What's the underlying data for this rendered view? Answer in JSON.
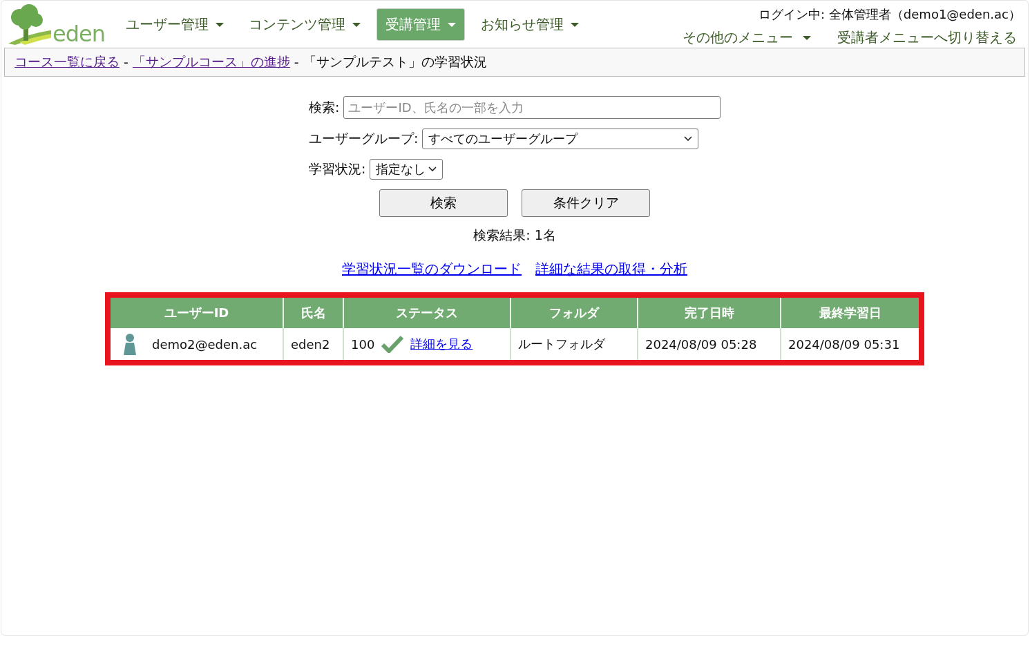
{
  "logo": {
    "text": "eden"
  },
  "nav": [
    {
      "label": "ユーザー管理",
      "selected": false,
      "dropdown": true
    },
    {
      "label": "コンテンツ管理",
      "selected": false,
      "dropdown": true
    },
    {
      "label": "受講管理",
      "selected": true,
      "dropdown": true
    },
    {
      "label": "お知らせ管理",
      "selected": false,
      "dropdown": true
    }
  ],
  "login_info": "ログイン中: 全体管理者（demo1@eden.ac）",
  "secondary_nav": [
    {
      "label": "その他のメニュー",
      "dropdown": true
    },
    {
      "label": "受講者メニューへ切り替える",
      "dropdown": false
    }
  ],
  "breadcrumb": {
    "links": [
      "コース一覧に戻る",
      "「サンプルコース」の進捗"
    ],
    "separator": "-",
    "current": "「サンプルテスト」の学習状況"
  },
  "search": {
    "label": "検索:",
    "placeholder": "ユーザーID、氏名の一部を入力"
  },
  "user_group": {
    "label": "ユーザーグループ:",
    "value": "すべてのユーザーグループ"
  },
  "study_status": {
    "label": "学習状況:",
    "value": "指定なし"
  },
  "buttons": [
    "検索",
    "条件クリア"
  ],
  "result_count": "検索結果: 1名",
  "links": [
    "学習状況一覧のダウンロード",
    "詳細な結果の取得・分析"
  ],
  "table": {
    "highlighted": true,
    "columns": [
      "ユーザーID",
      "氏名",
      "ステータス",
      "フォルダ",
      "完了日時",
      "最終学習日"
    ],
    "rows": [
      {
        "user_id": "demo2@eden.ac",
        "name": "eden2",
        "score": "100",
        "completed": true,
        "detail_link": "詳細を見る",
        "folder": "ルートフォルダ",
        "completed_at": "2024/08/09 05:28",
        "last_study": "2024/08/09 05:31"
      }
    ]
  }
}
